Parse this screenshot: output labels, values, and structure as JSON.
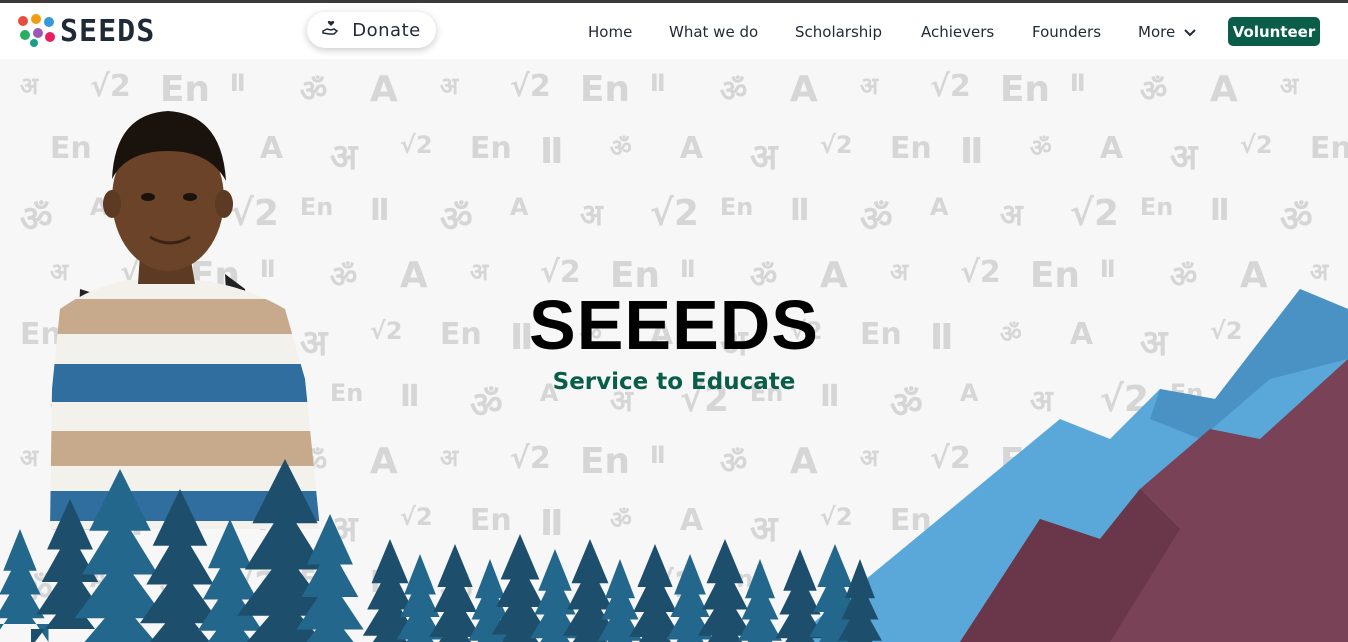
{
  "brand": {
    "logo_text": "SEEDS",
    "logo_colors": [
      "#e74c3c",
      "#f39c12",
      "#27ae60",
      "#3498db",
      "#9b59b6",
      "#e91e63"
    ]
  },
  "header": {
    "donate_label": "Donate",
    "donate_icon": "hand-heart-icon",
    "nav": [
      {
        "label": "Home"
      },
      {
        "label": "What we do"
      },
      {
        "label": "Scholarship"
      },
      {
        "label": "Achievers"
      },
      {
        "label": "Founders"
      },
      {
        "label": "More"
      }
    ],
    "volunteer_label": "Volunteer"
  },
  "hero": {
    "title": "SEEEDS",
    "subtitle": "Service to Educate",
    "pattern_icons": [
      "अ",
      "√2",
      "En",
      "Ⅱ",
      "ॐ",
      "A"
    ]
  },
  "colors": {
    "accent": "#0a5e49",
    "tree": "#1f5a7a",
    "mountain_blue": "#5aa8d9",
    "mountain_maroon": "#7a4256"
  }
}
